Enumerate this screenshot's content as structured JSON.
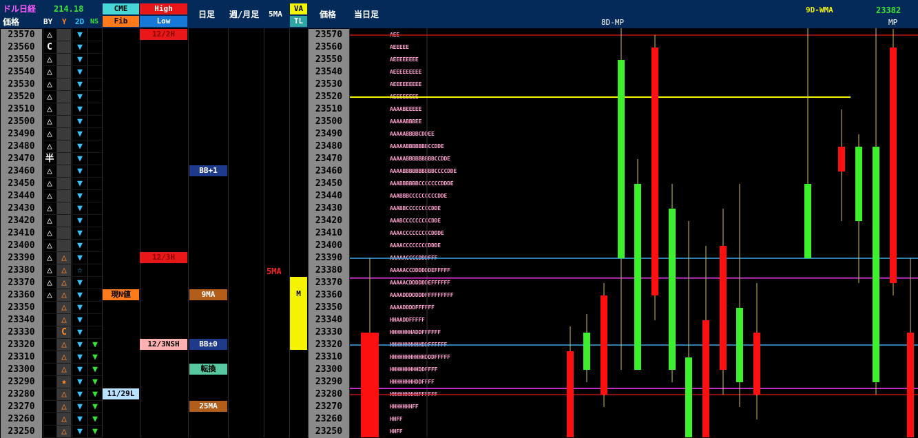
{
  "header": {
    "title_left": "ドル日経",
    "value_left": "214.18",
    "col_labels": {
      "price": "価格",
      "by": "BY",
      "y": "Y",
      "d2": "2D",
      "ns": "NS"
    },
    "cme": "CME",
    "high": "High",
    "fib": "Fib",
    "low": "Low",
    "daily": "日足",
    "weekly_monthly": "週/月足",
    "ma5": "5MA",
    "va": "VA",
    "tl": "TL",
    "price2": "価格",
    "today": "当日足",
    "wma_label": "9D-WMA",
    "wma_value": "23382",
    "center_label": "8D-MP",
    "mp_label": "MP"
  },
  "colors": {
    "green": "#3df02c",
    "red": "#ff1010",
    "yellow_line": "#f4f400",
    "magenta_line": "#ff3cff",
    "blue_line": "#3ea8e8",
    "dark_red_line": "#c01414"
  },
  "rows": [
    {
      "price": "23570",
      "by": "△",
      "y": "",
      "d2": "tri",
      "ns": "",
      "tpo": "AEE"
    },
    {
      "price": "23560",
      "by": "C",
      "y": "",
      "d2": "tri",
      "ns": "",
      "tpo": "AEEEEE"
    },
    {
      "price": "23550",
      "by": "△",
      "y": "",
      "d2": "tri",
      "ns": "",
      "tpo": "AEEEEEEEE"
    },
    {
      "price": "23540",
      "by": "△",
      "y": "",
      "d2": "tri",
      "ns": "",
      "tpo": "AEEEEEEEEE"
    },
    {
      "price": "23530",
      "by": "△",
      "y": "",
      "d2": "tri",
      "ns": "",
      "tpo": "AEEEEEEEEE"
    },
    {
      "price": "23520",
      "by": "△",
      "y": "",
      "d2": "tri",
      "ns": "",
      "tpo": "AEEEEEEEE"
    },
    {
      "price": "23510",
      "by": "△",
      "y": "",
      "d2": "tri",
      "ns": "",
      "tpo": "AAAABEEEEE"
    },
    {
      "price": "23500",
      "by": "△",
      "y": "",
      "d2": "tri",
      "ns": "",
      "tpo": "AAAAABBBEE"
    },
    {
      "price": "23490",
      "by": "△",
      "y": "",
      "d2": "tri",
      "ns": "",
      "tpo": "AAAAABBBBCDDEE"
    },
    {
      "price": "23480",
      "by": "△",
      "y": "",
      "d2": "tri",
      "ns": "",
      "tpo": "AAAAABBBBBBBCCDDE"
    },
    {
      "price": "23470",
      "by": "半",
      "y": "",
      "d2": "tri",
      "ns": "",
      "tpo": "AAAAABBBBBBBBBCCDDE"
    },
    {
      "price": "23460",
      "by": "△",
      "y": "",
      "d2": "tri",
      "ns": "",
      "tpo": "AAAABBBBBBBBBBCCCCDDE"
    },
    {
      "price": "23450",
      "by": "△",
      "y": "",
      "d2": "tri",
      "ns": "",
      "tpo": "AAABBBBBBCCCCCCCDDDE"
    },
    {
      "price": "23440",
      "by": "△",
      "y": "",
      "d2": "tri",
      "ns": "",
      "tpo": "AAABBBCCCCCCCCCDDE"
    },
    {
      "price": "23430",
      "by": "△",
      "y": "",
      "d2": "tri",
      "ns": "",
      "tpo": "AAABBCCCCCCCCDDE"
    },
    {
      "price": "23420",
      "by": "△",
      "y": "",
      "d2": "tri",
      "ns": "",
      "tpo": "AAABCCCCCCCCCDDE"
    },
    {
      "price": "23410",
      "by": "△",
      "y": "",
      "d2": "tri",
      "ns": "",
      "tpo": "AAAACCCCCCCCCDDDE"
    },
    {
      "price": "23400",
      "by": "△",
      "y": "",
      "d2": "tri",
      "ns": "",
      "tpo": "AAAACCCCCCCCDDDE"
    },
    {
      "price": "23390",
      "by": "△",
      "y": "△",
      "d2": "tri",
      "ns": "",
      "tpo": "AAAAACCCCDDDFFF"
    },
    {
      "price": "23380",
      "by": "△",
      "y": "△",
      "d2": "star",
      "ns": "",
      "tpo": "AAAAACCDDDDDDEFFFFF"
    },
    {
      "price": "23370",
      "by": "△",
      "y": "△",
      "d2": "tri",
      "ns": "",
      "tpo": "AAAAACDDDDDDEFFFFFF"
    },
    {
      "price": "23360",
      "by": "△",
      "y": "△",
      "d2": "tri",
      "ns": "",
      "tpo": "AAAADDDDDDDFFFFFFFFF"
    },
    {
      "price": "23350",
      "by": "",
      "y": "△",
      "d2": "tri",
      "ns": "",
      "tpo": "AAAADDDDFFFFFF"
    },
    {
      "price": "23340",
      "by": "",
      "y": "△",
      "d2": "tri",
      "ns": "",
      "tpo": "HHAADDFFFFF"
    },
    {
      "price": "23330",
      "by": "",
      "y": "C",
      "d2": "tri",
      "ns": "",
      "tpo": "HHHHHHHADDFFFFFF"
    },
    {
      "price": "23320",
      "by": "",
      "y": "△",
      "d2": "tri",
      "ns": "tri",
      "tpo": "HHHHHHHHHHDDFFFFFF"
    },
    {
      "price": "23310",
      "by": "",
      "y": "△",
      "d2": "tri",
      "ns": "tri",
      "tpo": "HHHHHHHHHHHDDDFFFFF"
    },
    {
      "price": "23300",
      "by": "",
      "y": "△",
      "d2": "tri",
      "ns": "tri",
      "tpo": "HHHHHHHHHDDFFFF"
    },
    {
      "price": "23290",
      "by": "",
      "y": "★",
      "d2": "tri",
      "ns": "tri",
      "tpo": "HHHHHHHHDDFFFF"
    },
    {
      "price": "23280",
      "by": "",
      "y": "△",
      "d2": "tri",
      "ns": "tri",
      "tpo": "HHHHHHHHHFFFFFF"
    },
    {
      "price": "23270",
      "by": "",
      "y": "△",
      "d2": "tri",
      "ns": "tri",
      "tpo": "HHHHHHHFF"
    },
    {
      "price": "23260",
      "by": "",
      "y": "△",
      "d2": "tri",
      "ns": "tri",
      "tpo": "HHFF"
    },
    {
      "price": "23250",
      "by": "",
      "y": "△",
      "d2": "tri",
      "ns": "tri",
      "tpo": "HHFF"
    }
  ],
  "badges": {
    "high_12_2h": "12/2H",
    "high_12_3h": "12/3H",
    "low_12_3nsh": "12/3NSH",
    "cme_genn": "現N値",
    "cme_11_29l": "11/29L",
    "bb_plus1": "BB+1",
    "ma9": "9MA",
    "bb_pm0": "BB±0",
    "tenkan": "転換",
    "ma25": "25MA",
    "ma5_marker": "5MA",
    "va_m": "M"
  },
  "chart_data": {
    "type": "candlestick",
    "ylim": [
      23245,
      23575
    ],
    "lines": [
      {
        "price": 23520,
        "color": "yellow"
      },
      {
        "price": 23390,
        "color": "blue"
      },
      {
        "price": 23374,
        "color": "magenta"
      },
      {
        "price": 23320,
        "color": "blue"
      },
      {
        "price": 23285,
        "color": "magenta"
      },
      {
        "price": 23570,
        "color": "dark_red"
      },
      {
        "price": 23280,
        "color": "dark_red"
      }
    ],
    "candles": [
      {
        "open": 23330,
        "close": 23245,
        "high": 23390,
        "low": 23245,
        "up": false,
        "big": true
      },
      {
        "open": 23315,
        "close": 23245,
        "high": 23335,
        "low": 23245,
        "up": false
      },
      {
        "open": 23300,
        "close": 23330,
        "high": 23345,
        "low": 23290,
        "up": true
      },
      {
        "open": 23360,
        "close": 23280,
        "high": 23370,
        "low": 23270,
        "up": false
      },
      {
        "open": 23390,
        "close": 23550,
        "high": 23580,
        "low": 23300,
        "up": true
      },
      {
        "open": 23300,
        "close": 23450,
        "high": 23470,
        "low": 23300,
        "up": true
      },
      {
        "open": 23560,
        "close": 23360,
        "high": 23570,
        "low": 23340,
        "up": false
      },
      {
        "open": 23300,
        "close": 23430,
        "high": 23450,
        "low": 23290,
        "up": true
      },
      {
        "open": 23245,
        "close": 23310,
        "high": 23420,
        "low": 23245,
        "up": true
      },
      {
        "open": 23340,
        "close": 23245,
        "high": 23400,
        "low": 23245,
        "up": false
      },
      {
        "open": 23400,
        "close": 23300,
        "high": 23430,
        "low": 23280,
        "up": false
      },
      {
        "open": 23290,
        "close": 23350,
        "high": 23450,
        "low": 23270,
        "up": true
      },
      {
        "open": 23330,
        "close": 23280,
        "high": 23370,
        "low": 23260,
        "up": false
      },
      {
        "open": 23390,
        "close": 23450,
        "high": 23580,
        "low": 23390,
        "up": true
      },
      {
        "open": 23480,
        "close": 23460,
        "high": 23510,
        "low": 23420,
        "up": false
      },
      {
        "open": 23420,
        "close": 23480,
        "high": 23490,
        "low": 23370,
        "up": true
      },
      {
        "open": 23290,
        "close": 23480,
        "high": 23580,
        "low": 23280,
        "up": true
      },
      {
        "open": 23560,
        "close": 23370,
        "high": 23575,
        "low": 23360,
        "up": false
      },
      {
        "open": 23330,
        "close": 23245,
        "high": 23390,
        "low": 23245,
        "up": false
      }
    ]
  }
}
